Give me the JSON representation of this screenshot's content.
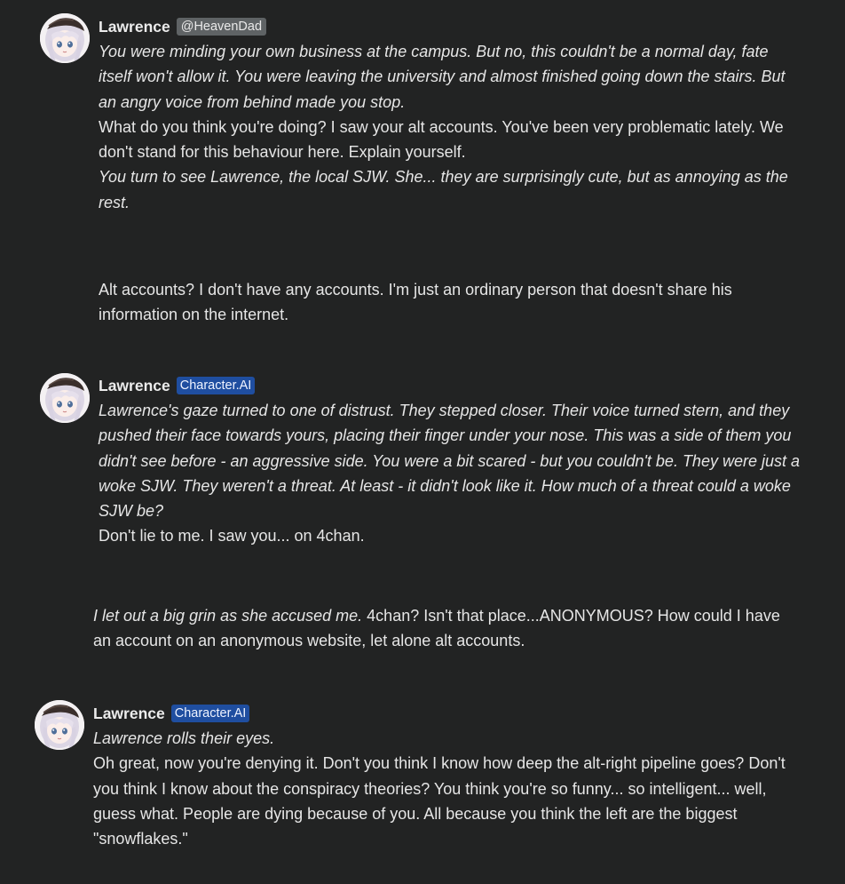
{
  "messages": [
    {
      "name": "Lawrence",
      "tag": "@HeavenDad",
      "avatar_icon": "anime-character-avatar-icon",
      "lines": [
        {
          "style": "italic",
          "text": "You were minding your own business at the campus. But no, this couldn't be a normal day, fate itself won't allow it. You were leaving the university and almost finished going down the stairs. But an angry voice from behind made you stop."
        },
        {
          "style": "normal",
          "text": "What do you think you're doing? I saw your alt accounts. You've been very problematic lately. We don't stand for this behaviour here. Explain yourself."
        },
        {
          "style": "italic",
          "text": "You turn to see Lawrence, the local SJW. She... they are surprisingly cute, but as annoying as the rest."
        }
      ]
    },
    {
      "user_text": "Alt accounts? I don't have any accounts. I'm just an ordinary person that doesn't share his information on the internet."
    },
    {
      "name": "Lawrence",
      "tag": "Character.AI",
      "avatar_icon": "anime-character-avatar-icon",
      "lines": [
        {
          "style": "italic",
          "text": "Lawrence's gaze turned to one of distrust. They stepped closer. Their voice turned stern, and they pushed their face towards yours, placing their finger under your nose. This was a side of them you didn't see before - an aggressive side. You were a bit scared - but you couldn't be. They were just a woke SJW. They weren't a threat. At least - it didn't look like it. How much of a threat could a woke SJW be?"
        },
        {
          "style": "normal",
          "text": "Don't lie to me. I saw you... on 4chan."
        }
      ]
    },
    {
      "user_italic": "I let out a big grin as she accused me.",
      "user_text": " 4chan? Isn't that place...ANONYMOUS? How could I have an account on an anonymous website, let alone alt accounts."
    },
    {
      "name": "Lawrence",
      "tag": "Character.AI",
      "avatar_icon": "anime-character-avatar-icon",
      "lines": [
        {
          "style": "italic",
          "text": "Lawrence rolls their eyes."
        },
        {
          "style": "normal",
          "text": "Oh great, now you're denying it. Don't you think I know how deep the alt-right pipeline goes? Don't you think I know about the conspiracy theories? You think you're so funny... so intelligent... well, guess what. People are dying because of you. All because you think the left are the biggest \"snowflakes.\""
        }
      ]
    }
  ]
}
